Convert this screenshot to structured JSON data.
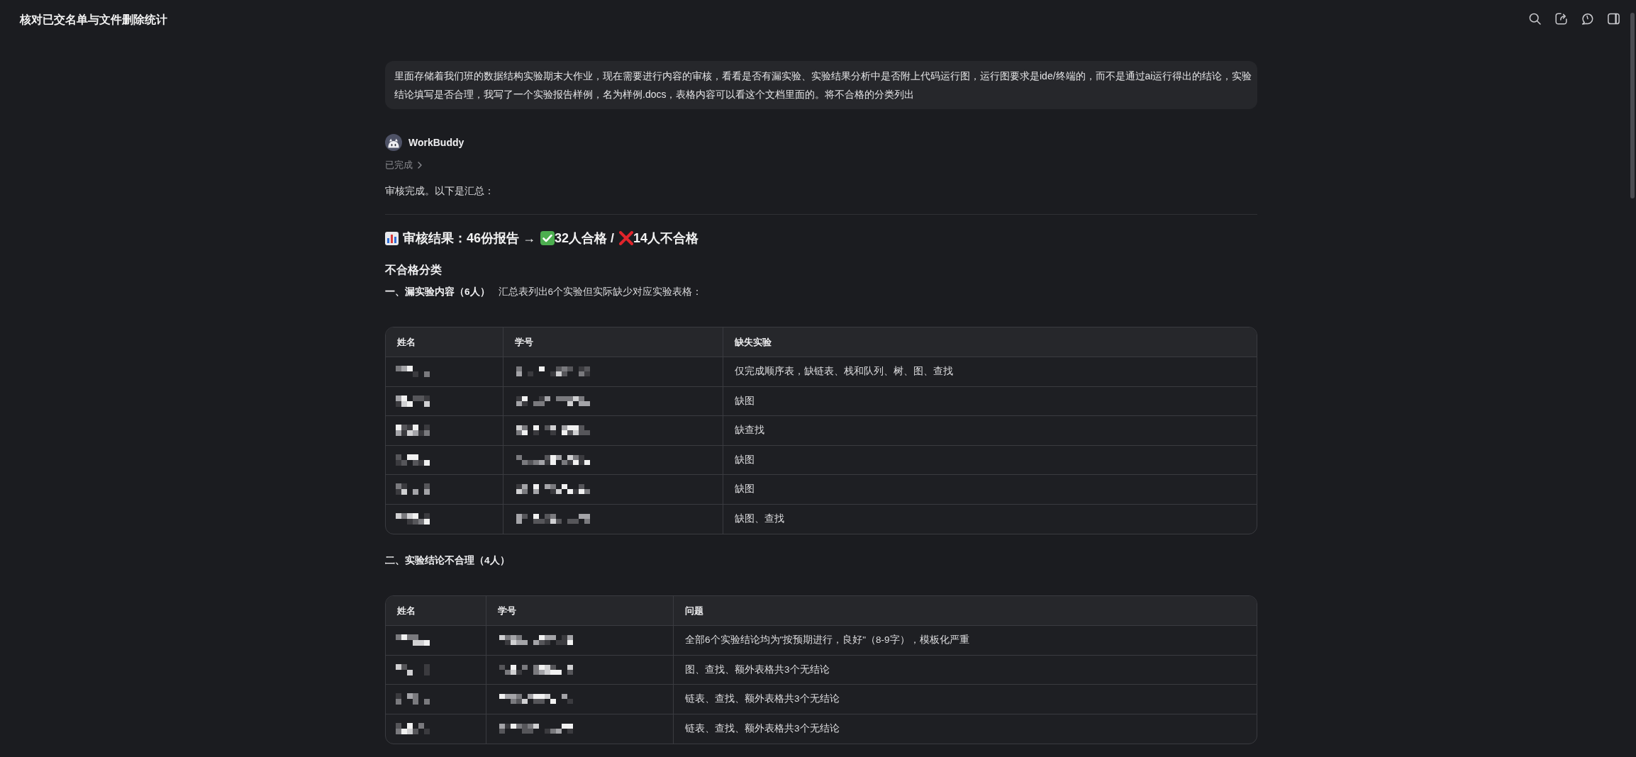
{
  "window": {
    "title": "核对已交名单与文件删除统计"
  },
  "user_message": {
    "text": "里面存储着我们班的数据结构实验期末大作业，现在需要进行内容的审核，看看是否有漏实验、实验结果分析中是否附上代码运行图，运行图要求是ide/终端的，而不是通过ai运行得出的结论，实验结论填写是否合理，我写了一个实验报告样例，名为样例.docs，表格内容可以看这个文档里面的。将不合格的分类列出"
  },
  "reply": {
    "author": "WorkBuddy",
    "status": "已完成",
    "intro": "审核完成。以下是汇总：",
    "headline": [
      "审核结果：46份报告 →",
      "32人合格 /",
      "14人不合格"
    ],
    "section_title": "不合格分类",
    "groups": [
      {
        "title": "一、漏实验内容（6人）",
        "note": "汇总表列出6个实验但实际缺少对应实验表格：",
        "table": {
          "columns": [
            "姓名",
            "学号",
            "缺失实验"
          ],
          "rows": [
            {
              "name_redacted": true,
              "id_redacted": true,
              "issue": "仅完成顺序表，缺链表、栈和队列、树、图、查找"
            },
            {
              "name_redacted": true,
              "id_redacted": true,
              "issue": "缺图"
            },
            {
              "name_redacted": true,
              "id_redacted": true,
              "issue": "缺查找"
            },
            {
              "name_redacted": true,
              "id_redacted": true,
              "issue": "缺图"
            },
            {
              "name_redacted": true,
              "id_redacted": true,
              "issue": "缺图"
            },
            {
              "name_redacted": true,
              "id_redacted": true,
              "issue": "缺图、查找"
            }
          ]
        }
      },
      {
        "title": "二、实验结论不合理（4人）",
        "table": {
          "columns": [
            "姓名",
            "学号",
            "问题"
          ],
          "rows": [
            {
              "name_redacted": true,
              "id_redacted": true,
              "issue": "全部6个实验结论均为\"按预期进行，良好\"（8-9字），模板化严重"
            },
            {
              "name_redacted": true,
              "id_redacted": true,
              "issue": "图、查找、额外表格共3个无结论"
            },
            {
              "name_redacted": true,
              "id_redacted": true,
              "issue": "链表、查找、额外表格共3个无结论"
            },
            {
              "name_redacted": true,
              "id_redacted": true,
              "issue": "链表、查找、额外表格共3个无结论"
            }
          ]
        }
      }
    ]
  }
}
